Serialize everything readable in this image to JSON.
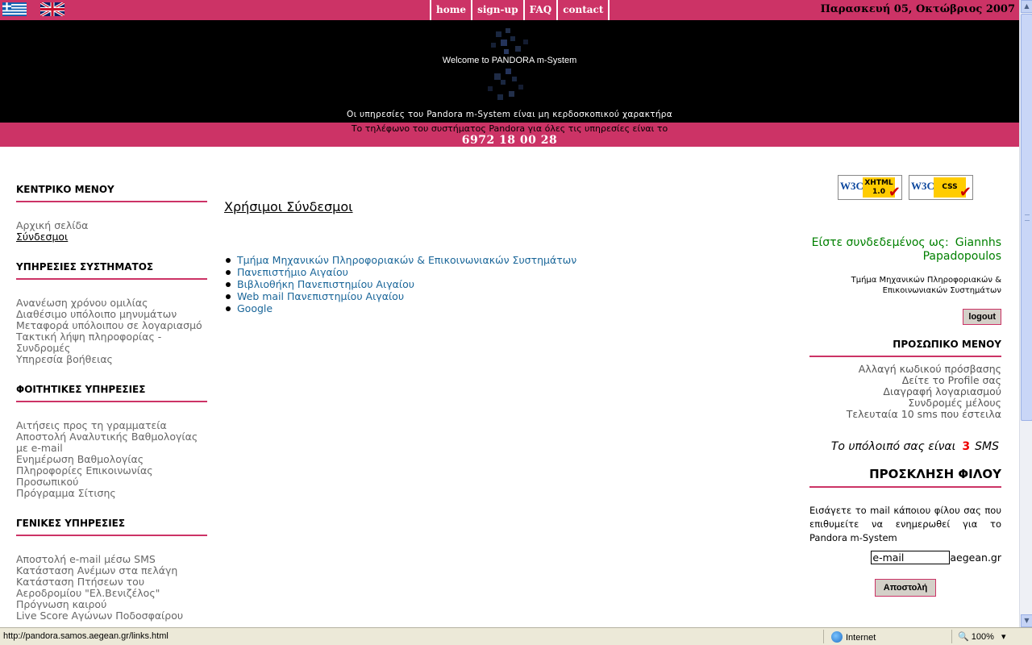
{
  "topbar": {
    "nav": [
      "home",
      "sign-up",
      "FAQ",
      "contact"
    ],
    "date": "Παρασκευή 05, Οκτώβριος 2007"
  },
  "banner": {
    "welcome": "Welcome to PANDORA m-System",
    "note": "Οι υπηρεσίες του Pandora m-System είναι μη κερδοσκοπικού χαρακτήρα",
    "phone_text": "Το τηλέφωνο του συστήματος Pandora για όλες τις υπηρεσίες είναι το",
    "phone_number": "6972 18 00 28"
  },
  "sidebar": {
    "sections": [
      {
        "title": "ΚΕΝΤΡΙΚΟ ΜΕΝΟΥ",
        "items": [
          "Αρχική σελίδα",
          "Σύνδεσμοι"
        ]
      },
      {
        "title": "ΥΠΗΡΕΣΙΕΣ ΣΥΣΤΗΜΑΤΟΣ",
        "items": [
          "Ανανέωση χρόνου ομιλίας",
          "Διαθέσιμο υπόλοιπο μηνυμάτων",
          "Μεταφορά υπόλοιπου σε λογαριασμό",
          "Τακτική λήψη πληροφορίας - Συνδρομές",
          "Υπηρεσία βοήθειας"
        ]
      },
      {
        "title": "ΦΟΙΤΗΤΙΚΕΣ ΥΠΗΡΕΣΙΕΣ",
        "items": [
          "Αιτήσεις προς τη γραμματεία",
          "Αποστολή Αναλυτικής Βαθμολογίας με e-mail",
          "Ενημέρωση Βαθμολογίας",
          "Πληροφορίες Επικοινωνίας Προσωπικού",
          "Πρόγραμμα Σίτισης"
        ]
      },
      {
        "title": "ΓΕΝΙΚΕΣ ΥΠΗΡΕΣΙΕΣ",
        "items": [
          "Αποστολή e-mail μέσω SMS",
          "Κατάσταση Ανέμων στα πελάγη",
          "Κατάσταση Πτήσεων του Αεροδρομίου \"Ελ.Βενιζέλος\"",
          "Πρόγνωση καιρού",
          "Live Score Αγώνων Ποδοσφαίρου"
        ]
      }
    ]
  },
  "main": {
    "title": "Χρήσιμοι Σύνδεσμοι",
    "links": [
      "Τμήμα Μηχανικών Πληροφοριακών & Επικοινωνιακών Συστημάτων",
      "Πανεπιστήμιο Αιγαίου",
      "Βιβλιοθήκη Πανεπιστημίου Αιγαίου",
      "Web mail Πανεπιστημίου Αιγαίου",
      "Google"
    ]
  },
  "badges": {
    "w3c": "W3C",
    "xhtml": "XHTML 1.0",
    "css": "CSS"
  },
  "right": {
    "login_label": "Είστε συνδεδεμένος ως:",
    "user_first": "Giannhs",
    "user_last": "Papadopoulos",
    "dept": "Τμήμα Μηχανικών Πληροφοριακών & Επικοινωνιακών Συστημάτων",
    "logout": "logout",
    "personal_title": "ΠΡΟΣΩΠΙΚΟ ΜΕΝΟΥ",
    "personal_items": [
      "Αλλαγή κωδικού πρόσβασης",
      "Δείτε το Profile σας",
      "Διαγραφή λογαριασμού",
      "Συνδρομές μέλους",
      "Τελευταία 10 sms που έστειλα"
    ],
    "balance_text": "Το υπόλοιπό σας είναι",
    "balance_value": "3",
    "balance_unit": "SMS",
    "invite_title": "ΠΡΟΣΚΛΗΣΗ ΦΙΛΟΥ",
    "invite_text": "Εισάγετε το mail κάποιου φίλου σας που επιθυμείτε να ενημερωθεί για το Pandora m-System",
    "email_value": "e-mail",
    "email_suffix": "aegean.gr",
    "send": "Αποστολή"
  },
  "statusbar": {
    "url": "http://pandora.samos.aegean.gr/links.html",
    "zone": "Internet",
    "zoom": "100%"
  },
  "colors": {
    "accent": "#cc3366",
    "banner": "#000000",
    "link": "#1a6699",
    "login": "#008000",
    "balance": "#ee0000"
  }
}
